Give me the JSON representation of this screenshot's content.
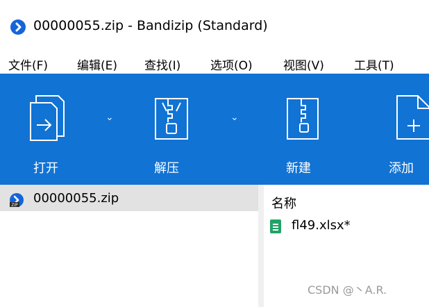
{
  "window": {
    "title": "00000055.zip - Bandizip (Standard)",
    "icon": "bandizip-app-icon"
  },
  "menubar": {
    "items": [
      {
        "label": "文件(F)"
      },
      {
        "label": "编辑(E)"
      },
      {
        "label": "查找(I)"
      },
      {
        "label": "选项(O)"
      },
      {
        "label": "视图(V)"
      },
      {
        "label": "工具(T)"
      }
    ]
  },
  "toolbar": {
    "background": "#1173d4",
    "buttons": [
      {
        "label": "打开",
        "icon": "open-icon",
        "has_dropdown": true
      },
      {
        "label": "解压",
        "icon": "extract-icon",
        "has_dropdown": true
      },
      {
        "label": "新建",
        "icon": "new-archive-icon",
        "has_dropdown": false
      },
      {
        "label": "添加",
        "icon": "add-icon",
        "has_dropdown": false
      }
    ]
  },
  "tree": {
    "items": [
      {
        "label": "00000055.zip",
        "icon": "zip-archive-icon",
        "selected": true
      }
    ]
  },
  "filelist": {
    "columns": [
      {
        "label": "名称"
      }
    ],
    "rows": [
      {
        "name": "fl49.xlsx*",
        "icon": "xlsx-file-icon"
      }
    ]
  },
  "watermark": "CSDN @丶A.R."
}
